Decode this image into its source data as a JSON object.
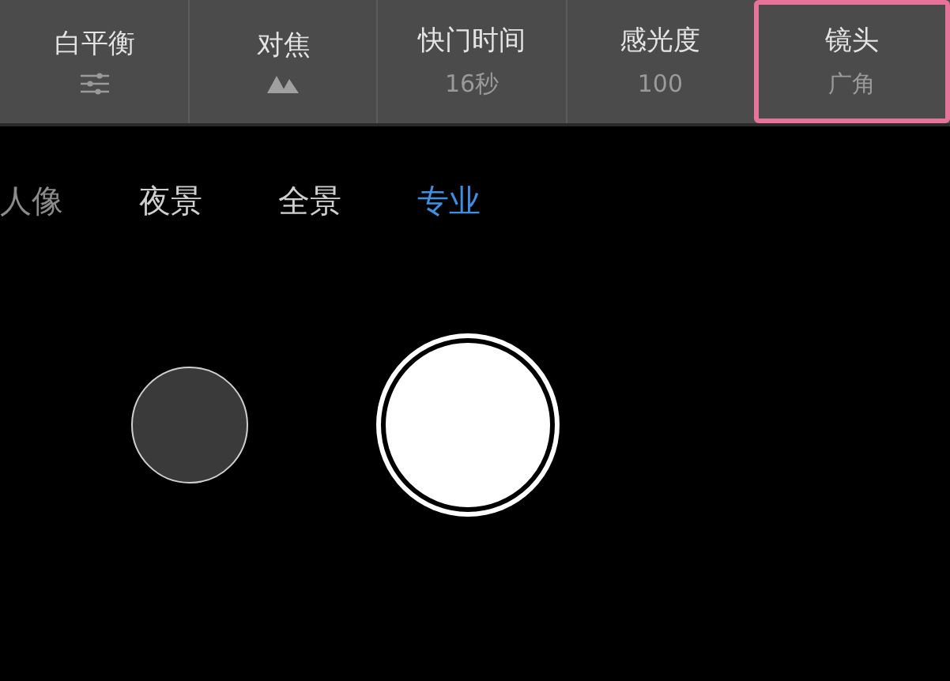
{
  "settings": [
    {
      "label": "白平衡",
      "kind": "sliders",
      "highlighted": false
    },
    {
      "label": "对焦",
      "kind": "mountains",
      "highlighted": false
    },
    {
      "label": "快门时间",
      "kind": "value",
      "value": "16秒",
      "highlighted": false
    },
    {
      "label": "感光度",
      "kind": "value",
      "value": "100",
      "highlighted": false
    },
    {
      "label": "镜头",
      "kind": "value",
      "value": "广角",
      "highlighted": true
    }
  ],
  "modes": [
    {
      "label": "人像",
      "selected": false
    },
    {
      "label": "夜景",
      "selected": false
    },
    {
      "label": "全景",
      "selected": false
    },
    {
      "label": "专业",
      "selected": true
    }
  ]
}
